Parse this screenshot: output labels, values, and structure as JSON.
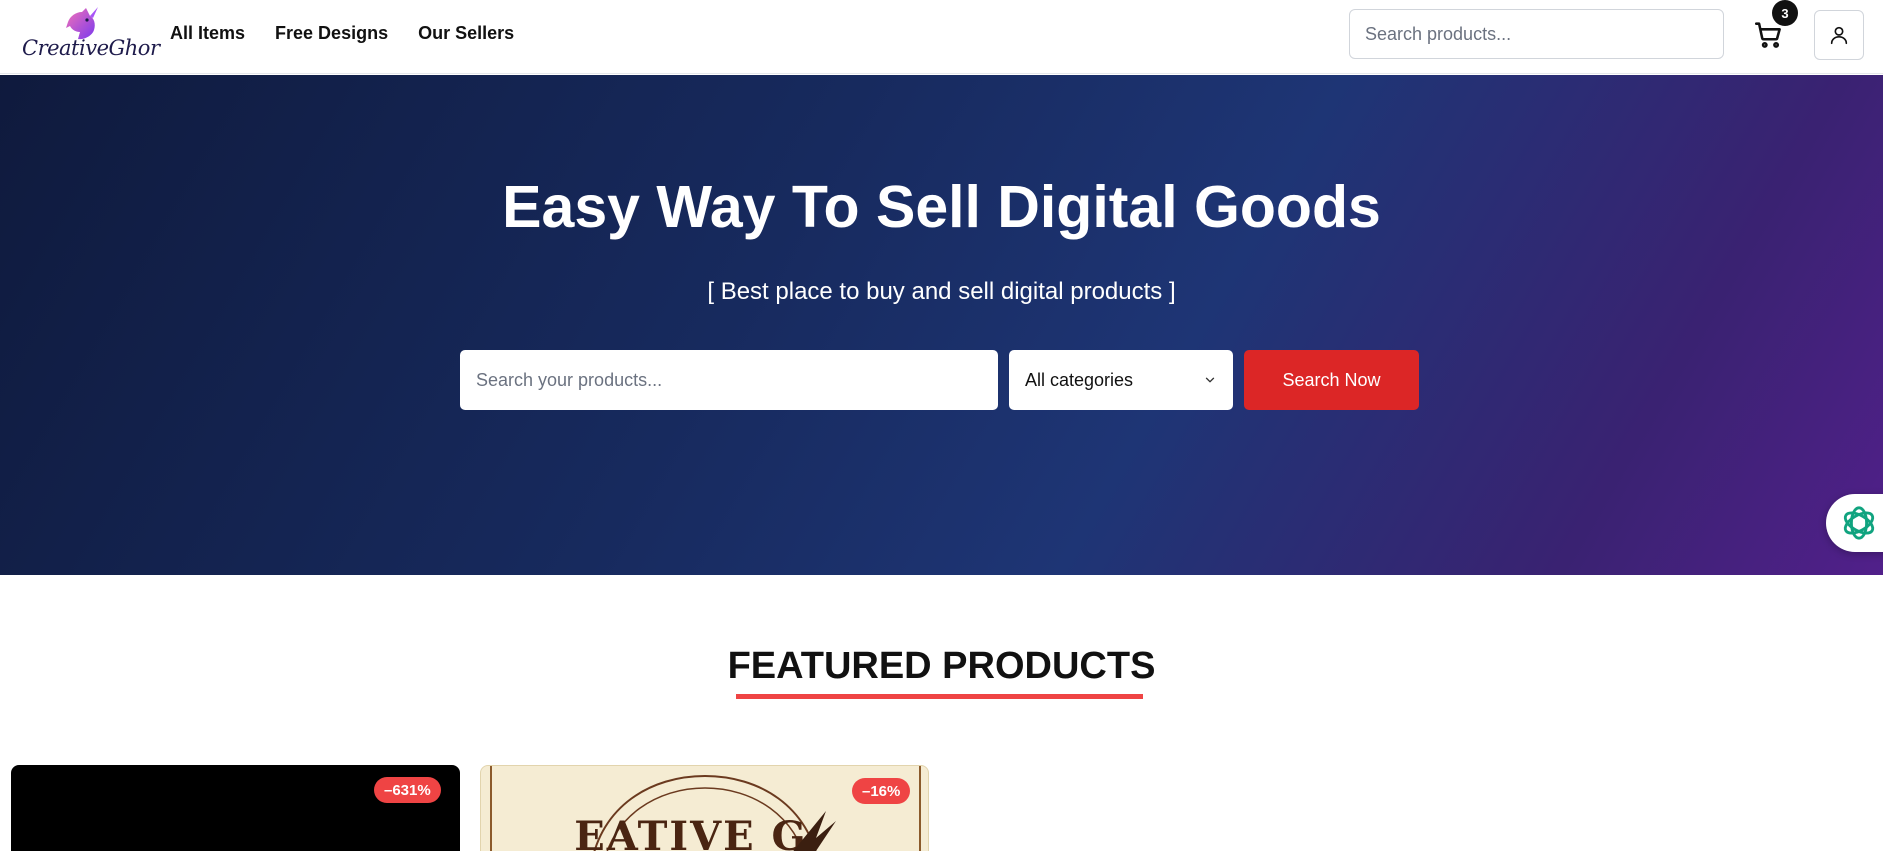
{
  "header": {
    "logo_text": "CreativeGhor",
    "nav": [
      "All Items",
      "Free Designs",
      "Our Sellers"
    ],
    "search_placeholder": "Search products...",
    "cart_count": "3",
    "icons": {
      "cart": "shopping-cart-icon",
      "user": "user-icon"
    }
  },
  "hero": {
    "title": "Easy Way To Sell Digital Goods",
    "subtitle": "[ Best place to buy and sell digital products ]",
    "search_placeholder": "Search your products...",
    "category_selected": "All categories",
    "search_button": "Search Now",
    "colors": {
      "button": "#dc2626",
      "gradient_start": "#0f1a3d",
      "gradient_end": "#51208a"
    }
  },
  "featured": {
    "title": "FEATURED PRODUCTS",
    "products": [
      {
        "discount": "–631%"
      },
      {
        "discount": "–16%"
      }
    ]
  }
}
